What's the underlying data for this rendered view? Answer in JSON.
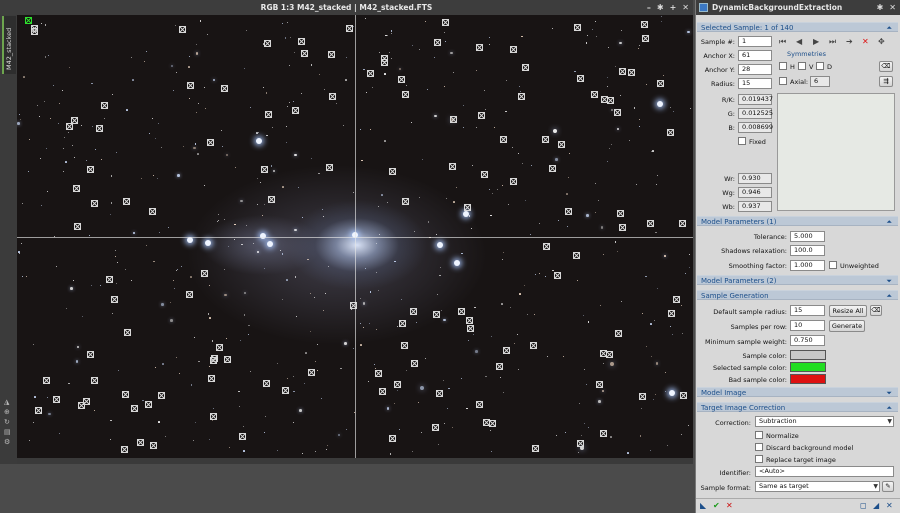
{
  "image_window": {
    "title": "RGB 1:3 M42_stacked | M42_stacked.FTS",
    "side_tab": "M42_stacked",
    "controls": [
      "–",
      "✱",
      "+",
      "✕"
    ]
  },
  "panel": {
    "title": "DynamicBackgroundExtraction",
    "pin_controls": [
      "✱",
      "✕"
    ],
    "selected_sample": {
      "header": "Selected Sample: 1 of 140",
      "sample_label": "Sample #:",
      "sample_value": "1",
      "anchor_x_label": "Anchor X:",
      "anchor_x_value": "61",
      "anchor_y_label": "Anchor Y:",
      "anchor_y_value": "28",
      "radius_label": "Radius:",
      "radius_value": "15",
      "rk_label": "R/K:",
      "rk_value": "0.019437",
      "g_label": "G:",
      "g_value": "0.012525",
      "b_label": "B:",
      "b_value": "0.008699",
      "fixed_label": "Fixed",
      "wr_label": "Wr:",
      "wr_value": "0.930",
      "wg_label": "Wg:",
      "wg_value": "0.946",
      "wb_label": "Wb:",
      "wb_value": "0.937",
      "symmetries_label": "Symmetries",
      "h_label": "H",
      "v_label": "V",
      "d_label": "D",
      "axial_label": "Axial:",
      "axial_value": "6"
    },
    "model_params_1": {
      "header": "Model Parameters (1)",
      "tolerance_label": "Tolerance:",
      "tolerance_value": "5.000",
      "shadows_label": "Shadows relaxation:",
      "shadows_value": "100.0",
      "smoothing_label": "Smoothing factor:",
      "smoothing_value": "1.000",
      "unweighted_label": "Unweighted"
    },
    "model_params_2": {
      "header": "Model Parameters (2)"
    },
    "sample_generation": {
      "header": "Sample Generation",
      "default_radius_label": "Default sample radius:",
      "default_radius_value": "15",
      "resize_all_label": "Resize All",
      "per_row_label": "Samples per row:",
      "per_row_value": "10",
      "generate_label": "Generate",
      "min_weight_label": "Minimum sample weight:",
      "min_weight_value": "0.750",
      "sample_color_label": "Sample color:",
      "sample_color": "#c8c8c8",
      "selected_color_label": "Selected sample color:",
      "selected_color": "#22dd22",
      "bad_color_label": "Bad sample color:",
      "bad_color": "#dd1111"
    },
    "model_image": {
      "header": "Model Image"
    },
    "target_correction": {
      "header": "Target Image Correction",
      "correction_label": "Correction:",
      "correction_value": "Subtraction",
      "normalize_label": "Normalize",
      "discard_label": "Discard background model",
      "replace_label": "Replace target image",
      "identifier_label": "Identifier:",
      "identifier_value": "<Auto>",
      "format_label": "Sample format:",
      "format_value": "Same as target"
    }
  }
}
